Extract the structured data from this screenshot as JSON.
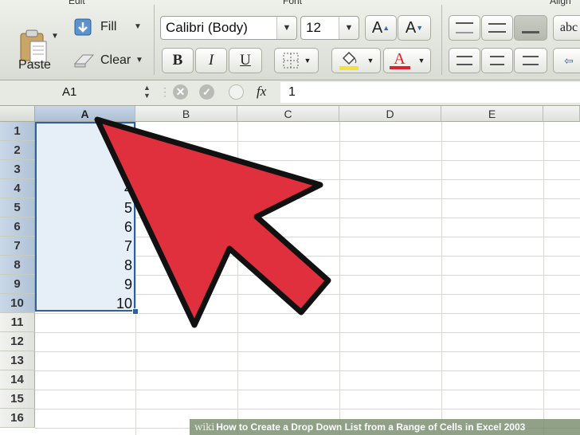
{
  "ribbon": {
    "groups": {
      "edit": "Edit",
      "font": "Font",
      "alignment": "Align"
    },
    "paste_label": "Paste",
    "fill_label": "Fill",
    "clear_label": "Clear",
    "font_name": "Calibri (Body)",
    "font_size": "12",
    "grow_font": "A",
    "shrink_font": "A",
    "bold": "B",
    "italic": "I",
    "underline": "U",
    "font_color_letter": "A",
    "orientation_label": "abc",
    "colors": {
      "highlight": "#f4e23a",
      "font_color": "#d8232a"
    }
  },
  "formula_bar": {
    "name_box": "A1",
    "fx": "fx",
    "value": "1"
  },
  "sheet": {
    "columns": [
      "A",
      "B",
      "C",
      "D",
      "E"
    ],
    "rows": [
      "1",
      "2",
      "3",
      "4",
      "5",
      "6",
      "7",
      "8",
      "9",
      "10",
      "11",
      "12",
      "13",
      "14",
      "15",
      "16"
    ],
    "column_a_values": [
      "",
      "",
      "",
      "4",
      "5",
      "6",
      "7",
      "8",
      "9",
      "10"
    ]
  },
  "overlay": {
    "arrow_color": "#e0303e"
  },
  "footer": {
    "wiki": "wiki",
    "title": "How to Create a Drop Down List from a Range of Cells in Excel 2003"
  }
}
